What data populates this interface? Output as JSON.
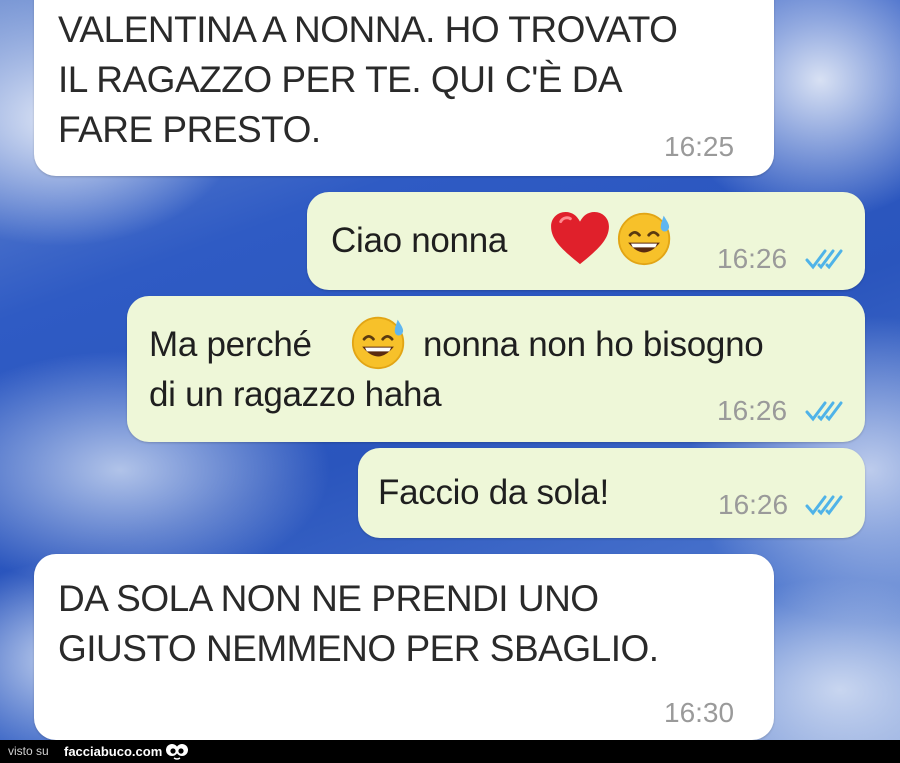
{
  "messages": [
    {
      "id": "m1",
      "direction": "incoming",
      "text_lines": [
        "VALENTINA A NONNA. HO TROVATO",
        "IL RAGAZZO PER TE. QUI C'È DA",
        "FARE PRESTO."
      ],
      "time": "16:25"
    },
    {
      "id": "m2",
      "direction": "outgoing",
      "text": "Ciao nonna",
      "emojis": [
        "heart-emoji",
        "sweat-smile-emoji"
      ],
      "time": "16:26",
      "status": "read"
    },
    {
      "id": "m3",
      "direction": "outgoing",
      "text_before": "Ma perché",
      "text_after": "nonna non ho bisogno",
      "text_line2": "di un ragazzo haha",
      "emojis": [
        "sweat-smile-emoji"
      ],
      "time": "16:26",
      "status": "read"
    },
    {
      "id": "m4",
      "direction": "outgoing",
      "text": "Faccio da sola!",
      "time": "16:26",
      "status": "read"
    },
    {
      "id": "m5",
      "direction": "incoming",
      "text_lines": [
        "DA SOLA NON NE PRENDI UNO",
        "GIUSTO NEMMENO PER SBAGLIO."
      ],
      "time": "16:30"
    }
  ],
  "footer": {
    "prefix": "visto su",
    "site": "facciabuco.com"
  },
  "colors": {
    "incoming_bubble": "#ffffff",
    "outgoing_bubble": "#eef7d8",
    "read_ticks": "#4fb3e8",
    "timestamp": "#9a9a9a"
  }
}
